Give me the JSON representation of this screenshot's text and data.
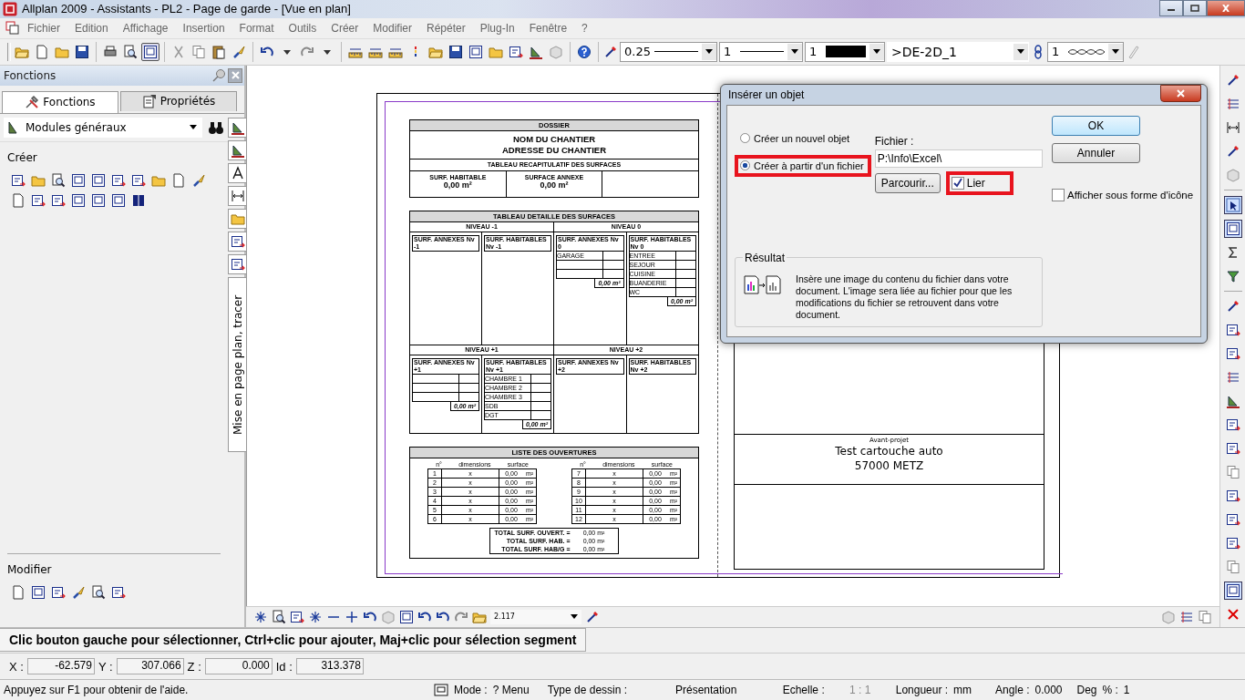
{
  "window": {
    "title": "Allplan 2009 - Assistants - PL2 - Page de garde - [Vue en plan]"
  },
  "menu": [
    "Fichier",
    "Edition",
    "Affichage",
    "Insertion",
    "Format",
    "Outils",
    "Créer",
    "Modifier",
    "Répéter",
    "Plug-In",
    "Fenêtre",
    "?"
  ],
  "toolbar": {
    "pen": "0.25",
    "line": "1",
    "color_number": "1",
    "color": "#000000",
    "layer": ">DE-2D_1",
    "pattern": "1"
  },
  "panel": {
    "title": "Fonctions",
    "tabs": [
      {
        "label": "Fonctions",
        "selected": true
      },
      {
        "label": "Propriétés",
        "selected": false
      }
    ],
    "module": "Modules généraux",
    "sections": [
      {
        "title": "Créer"
      },
      {
        "title": "Modifier"
      }
    ],
    "side_tab": "Mise en page plan, tracer"
  },
  "sheet": {
    "dossier": {
      "header": "DOSSIER",
      "name": "NOM DU CHANTIER",
      "address": "ADRESSE DU CHANTIER",
      "summary_title": "TABLEAU RECAPITULATIF DES SURFACES",
      "summary": [
        {
          "label": "SURF. HABITABLE",
          "value": "0,00 m²"
        },
        {
          "label": "SURFACE ANNEXE",
          "value": "0,00 m²"
        }
      ]
    },
    "detail": {
      "title": "TABLEAU DETAILLE DES SURFACES",
      "levels": [
        {
          "name": "NIVEAU -1",
          "groups": [
            {
              "title": "SURF. ANNEXES Nv -1"
            },
            {
              "title": "SURF. HABITABLES Nv -1"
            }
          ]
        },
        {
          "name": "NIVEAU 0",
          "groups": [
            {
              "title": "SURF. ANNEXES Nv 0",
              "rows": [
                {
                  "label": "GARAGE"
                },
                {},
                {}
              ],
              "total": "0,00 m²"
            },
            {
              "title": "SURF. HABITABLES Nv 0",
              "rows": [
                {
                  "label": "ENTREE"
                },
                {
                  "label": "SEJOUR"
                },
                {
                  "label": "CUISINE"
                },
                {
                  "label": "BUANDERIE"
                },
                {
                  "label": "WC"
                }
              ],
              "total": "0,00 m²"
            }
          ]
        },
        {
          "name": "NIVEAU +1",
          "groups": [
            {
              "title": "SURF. ANNEXES Nv +1",
              "rows": [
                {},
                {},
                {}
              ],
              "total": "0,00 m²"
            },
            {
              "title": "SURF. HABITABLES Nv +1",
              "rows": [
                {
                  "label": "CHAMBRE 1"
                },
                {
                  "label": "CHAMBRE 2"
                },
                {
                  "label": "CHAMBRE 3"
                },
                {
                  "label": "SDB"
                },
                {
                  "label": "DGT"
                }
              ],
              "total": "0,00 m²"
            }
          ]
        },
        {
          "name": "NIVEAU +2",
          "groups": [
            {
              "title": "SURF. ANNEXES Nv +2"
            },
            {
              "title": "SURF. HABITABLES Nv +2"
            }
          ]
        }
      ]
    },
    "openings": {
      "title": "LISTE DES OUVERTURES",
      "tables": [
        {
          "columns": [
            "n°",
            "dimensions",
            "surface"
          ],
          "rows": [
            {
              "n": "1",
              "dim": "x",
              "surface": "0,00",
              "unit": "m²"
            },
            {
              "n": "2",
              "dim": "x",
              "surface": "0,00",
              "unit": "m²"
            },
            {
              "n": "3",
              "dim": "x",
              "surface": "0,00",
              "unit": "m²"
            },
            {
              "n": "4",
              "dim": "x",
              "surface": "0,00",
              "unit": "m²"
            },
            {
              "n": "5",
              "dim": "x",
              "surface": "0,00",
              "unit": "m²"
            },
            {
              "n": "6",
              "dim": "x",
              "surface": "0,00",
              "unit": "m²"
            }
          ]
        },
        {
          "columns": [
            "n°",
            "dimensions",
            "surface"
          ],
          "rows": [
            {
              "n": "7",
              "dim": "x",
              "surface": "0,00",
              "unit": "m²"
            },
            {
              "n": "8",
              "dim": "x",
              "surface": "0,00",
              "unit": "m²"
            },
            {
              "n": "9",
              "dim": "x",
              "surface": "0,00",
              "unit": "m²"
            },
            {
              "n": "10",
              "dim": "x",
              "surface": "0,00",
              "unit": "m²"
            },
            {
              "n": "11",
              "dim": "x",
              "surface": "0,00",
              "unit": "m²"
            },
            {
              "n": "12",
              "dim": "x",
              "surface": "0,00",
              "unit": "m²"
            }
          ]
        }
      ],
      "totals": [
        {
          "label": "TOTAL SURF. OUVERT. =",
          "value": "0,00 m²"
        },
        {
          "label": "TOTAL SURF. HAB. =",
          "value": "0,00 m²"
        },
        {
          "label": "TOTAL SURF. HAB/G =",
          "value": "0,00 m²"
        }
      ]
    },
    "title_block": {
      "phase": "Avant-projet",
      "project": "Test cartouche auto",
      "city": "57000 METZ"
    }
  },
  "dialog": {
    "title": "Insérer un objet",
    "options": [
      {
        "label": "Créer un nouvel objet",
        "selected": false,
        "highlighted": false
      },
      {
        "label": "Créer à partir d'un fichier",
        "selected": true,
        "highlighted": true
      }
    ],
    "file_label": "Fichier :",
    "file_value": "P:\\Info\\Excel\\",
    "browse": "Parcourir...",
    "link": {
      "label": "Lier",
      "checked": true,
      "highlighted": true
    },
    "ok": "OK",
    "cancel": "Annuler",
    "as_icon": {
      "label": "Afficher sous forme d'icône",
      "checked": false
    },
    "result": {
      "title": "Résultat",
      "text": "Insère une image du contenu du fichier dans votre document. L'image sera liée au fichier pour que les modifications du fichier se retrouvent dans votre document."
    }
  },
  "canvas_toolbar": {
    "zoom": "2.117"
  },
  "message": "Clic bouton gauche pour sélectionner, Ctrl+clic pour ajouter, Maj+clic pour sélection segment",
  "coordinates": [
    {
      "label": "X :",
      "value": "-62.579"
    },
    {
      "label": "Y :",
      "value": "307.066"
    },
    {
      "label": "Z :",
      "value": "0.000"
    },
    {
      "label": "Id :",
      "value": "313.378"
    }
  ],
  "status_bar": {
    "help": "Appuyez sur F1 pour obtenir de l'aide.",
    "fields": [
      {
        "text": "Mode :"
      },
      {
        "text": "? Menu"
      },
      {
        "text": "Type de dessin :"
      },
      {
        "text": "Présentation"
      },
      {
        "text": "Echelle :"
      },
      {
        "text": "1 : 1"
      },
      {
        "text": "Longueur :"
      },
      {
        "text": "mm"
      },
      {
        "text": "Angle :"
      },
      {
        "text": "0.000"
      },
      {
        "text": "Deg"
      },
      {
        "text": "% :"
      },
      {
        "text": "1"
      }
    ]
  }
}
